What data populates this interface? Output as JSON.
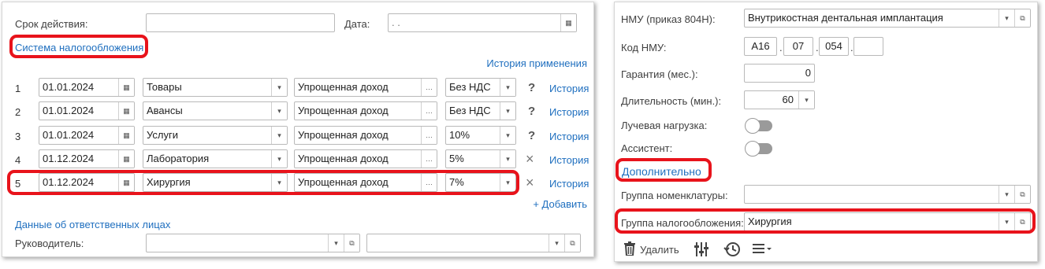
{
  "left": {
    "validity_label": "Срок действия:",
    "date_label": "Дата:",
    "date_value": " .  .",
    "tax_system_link": "Система налогообложения",
    "history_link": "История применения",
    "rows": [
      {
        "num": "1",
        "date": "01.01.2024",
        "category": "Товары",
        "mode": "Упрощенная доход",
        "vat": "Без НДС",
        "mark": "?",
        "history": "История"
      },
      {
        "num": "2",
        "date": "01.01.2024",
        "category": "Авансы",
        "mode": "Упрощенная доход",
        "vat": "Без НДС",
        "mark": "?",
        "history": "История"
      },
      {
        "num": "3",
        "date": "01.01.2024",
        "category": "Услуги",
        "mode": "Упрощенная доход",
        "vat": "10%",
        "mark": "?",
        "history": "История"
      },
      {
        "num": "4",
        "date": "01.12.2024",
        "category": "Лаборатория",
        "mode": "Упрощенная доход",
        "vat": "5%",
        "mark": "×",
        "history": "История"
      },
      {
        "num": "5",
        "date": "01.12.2024",
        "category": "Хирургия",
        "mode": "Упрощенная доход",
        "vat": "7%",
        "mark": "×",
        "history": "История"
      }
    ],
    "add_link": "+ Добавить",
    "responsible_link": "Данные об ответственных лицах",
    "head_label": "Руководитель:"
  },
  "right": {
    "nmu_label": "НМУ (приказ 804Н):",
    "nmu_value": "Внутрикостная дентальная имплантация",
    "code_label": "Код НМУ:",
    "code_parts": [
      "A16",
      "07",
      "054",
      ""
    ],
    "code_sep": ".",
    "warranty_label": "Гарантия (мес.):",
    "warranty_value": "0",
    "duration_label": "Длительность (мин.):",
    "duration_value": "60",
    "radiation_label": "Лучевая нагрузка:",
    "assistant_label": "Ассистент:",
    "additional_link": "Дополнительно",
    "nomenclature_group_label": "Группа номенклатуры:",
    "tax_group_label": "Группа налогообложения:",
    "tax_group_value": "Хирургия",
    "delete_label": "Удалить"
  },
  "colors": {
    "link": "#1f6fbf",
    "highlight": "#e8131b"
  }
}
